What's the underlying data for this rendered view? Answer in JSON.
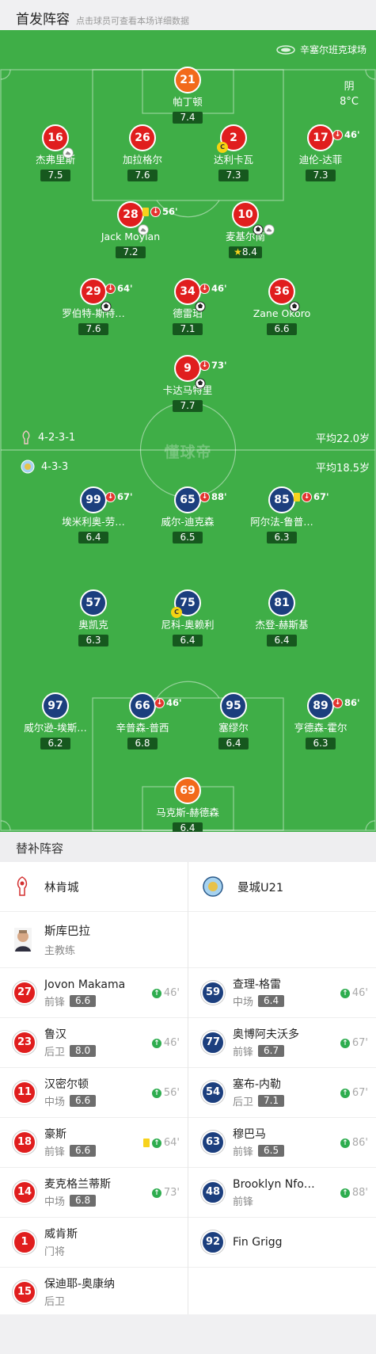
{
  "header": {
    "title": "首发阵容",
    "subtitle": "点击球员可查看本场详细数据"
  },
  "venue": "辛塞尔班克球场",
  "weather": {
    "condition": "阴",
    "temp": "8°C"
  },
  "watermark": "懂球帝",
  "home_team": {
    "formation": "4-2-3-1",
    "avg_age": "平均22.0岁"
  },
  "away_team": {
    "formation": "4-3-3",
    "avg_age": "平均18.5岁"
  },
  "home_lineup": [
    {
      "num": "21",
      "name": "帕丁顿",
      "rating": "7.4",
      "gk": true
    },
    {
      "num": "16",
      "name": "杰弗里斯",
      "rating": "7.5",
      "assist": true
    },
    {
      "num": "26",
      "name": "加拉格尔",
      "rating": "7.6"
    },
    {
      "num": "2",
      "name": "达利卡瓦",
      "rating": "7.3",
      "captain": true
    },
    {
      "num": "17",
      "name": "迪伦-达菲",
      "rating": "7.3",
      "sub_off": "46'"
    },
    {
      "num": "28",
      "name": "Jack Moylan",
      "rating": "7.2",
      "yellow": true,
      "sub_off": "56'",
      "assist": true
    },
    {
      "num": "10",
      "name": "麦基尔南",
      "rating": "8.4",
      "star": true,
      "goal": true,
      "assist": true
    },
    {
      "num": "29",
      "name": "罗伯特-斯特…",
      "rating": "7.6",
      "sub_off": "64'",
      "goal": true
    },
    {
      "num": "34",
      "name": "德雷珀",
      "rating": "7.1",
      "sub_off": "46'",
      "goal": true
    },
    {
      "num": "36",
      "name": "Zane Okoro",
      "rating": "6.6",
      "goal": true
    },
    {
      "num": "9",
      "name": "卡达马特里",
      "rating": "7.7",
      "sub_off": "73'",
      "goal": true
    }
  ],
  "away_lineup": [
    {
      "num": "99",
      "name": "埃米利奥-劳…",
      "rating": "6.4",
      "sub_off": "67'"
    },
    {
      "num": "65",
      "name": "威尔-迪克森",
      "rating": "6.5",
      "sub_off": "88'"
    },
    {
      "num": "85",
      "name": "阿尔法-鲁普…",
      "rating": "6.3",
      "yellow": true,
      "sub_off": "67'"
    },
    {
      "num": "57",
      "name": "奥凯克",
      "rating": "6.3"
    },
    {
      "num": "75",
      "name": "尼科-奥赖利",
      "rating": "6.4",
      "captain": true
    },
    {
      "num": "81",
      "name": "杰登-赫斯基",
      "rating": "6.4"
    },
    {
      "num": "97",
      "name": "威尔逊-埃斯…",
      "rating": "6.2"
    },
    {
      "num": "66",
      "name": "辛普森-普西",
      "rating": "6.8",
      "sub_off": "46'"
    },
    {
      "num": "95",
      "name": "塞缪尔",
      "rating": "6.4"
    },
    {
      "num": "89",
      "name": "亨德森-霍尔",
      "rating": "6.3",
      "sub_off": "86'"
    },
    {
      "num": "69",
      "name": "马克斯-赫德森",
      "rating": "6.4",
      "gk": true
    }
  ],
  "subs": {
    "title": "替补阵容",
    "home": {
      "team": "林肯城",
      "coach": {
        "name": "斯库巴拉",
        "role": "主教练"
      },
      "players": [
        {
          "num": "27",
          "name": "Jovon Makama",
          "pos": "前锋",
          "rating": "6.6",
          "in": "46'"
        },
        {
          "num": "23",
          "name": "鲁汉",
          "pos": "后卫",
          "rating": "8.0",
          "in": "46'"
        },
        {
          "num": "11",
          "name": "汉密尔顿",
          "pos": "中场",
          "rating": "6.6",
          "in": "56'"
        },
        {
          "num": "18",
          "name": "豪斯",
          "pos": "前锋",
          "rating": "6.6",
          "in": "64'",
          "yellow": true
        },
        {
          "num": "14",
          "name": "麦克格兰蒂斯",
          "pos": "中场",
          "rating": "6.8",
          "in": "73'"
        },
        {
          "num": "1",
          "name": "威肯斯",
          "pos": "门将"
        },
        {
          "num": "15",
          "name": "保迪耶-奥康纳",
          "pos": "后卫"
        }
      ]
    },
    "away": {
      "team": "曼城U21",
      "players": [
        {
          "num": "59",
          "name": "查理-格雷",
          "pos": "中场",
          "rating": "6.4",
          "in": "46'"
        },
        {
          "num": "77",
          "name": "奥博阿夫沃多",
          "pos": "前锋",
          "rating": "6.7",
          "in": "67'"
        },
        {
          "num": "54",
          "name": "塞布-内勒",
          "pos": "后卫",
          "rating": "7.1",
          "in": "67'"
        },
        {
          "num": "63",
          "name": "穆巴马",
          "pos": "前锋",
          "rating": "6.5",
          "in": "86'"
        },
        {
          "num": "48",
          "name": "Brooklyn Nfo…",
          "pos": "前锋",
          "in": "88'"
        },
        {
          "num": "92",
          "name": "Fin Grigg"
        }
      ]
    }
  }
}
